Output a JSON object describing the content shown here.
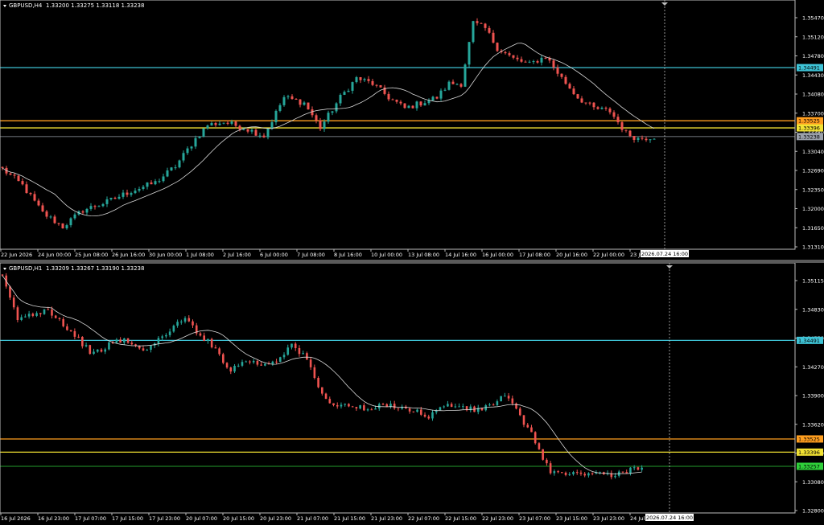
{
  "charts": [
    {
      "symbol": "GBPUSD,H4",
      "ohlc": "1.33200 1.33275 1.33118 1.33238",
      "y_axis": {
        "min": 1.3119,
        "max": 1.3572,
        "ticks": [
          "1.35470",
          "1.35120",
          "1.34780",
          "1.34430",
          "1.34080",
          "1.33700",
          "1.33380",
          "1.33040",
          "1.32690",
          "1.32350",
          "1.32000",
          "1.31650",
          "1.31310"
        ]
      },
      "x_labels": [
        "22 Jun 2026",
        "24 Jun 00:00",
        "25 Jun 08:00",
        "26 Jun 16:00",
        "30 Jun 00:00",
        "1 Jul 08:00",
        "2 Jul 16:00",
        "6 Jul 00:00",
        "7 Jul 08:00",
        "8 Jul 16:00",
        "10 Jul 00:00",
        "13 Jul 08:00",
        "14 Jul 16:00",
        "16 Jul 00:00",
        "17 Jul 08:00",
        "20 Jul 16:00",
        "22 Jul 00:00",
        "23 Jul"
      ],
      "cursor_time": "2026.07.24 16:00",
      "levels": [
        {
          "label": "1.34491",
          "value": 1.34491,
          "color": "#3ec3d6"
        },
        {
          "label": "1.33525",
          "value": 1.33525,
          "color": "#ff9e1f"
        },
        {
          "label": "1.33396",
          "value": 1.33396,
          "color": "#f2e233"
        }
      ],
      "current": {
        "label": "1.33238",
        "value": 1.33238,
        "color": "#9aa0aa"
      },
      "anchors": [
        [
          0,
          1.3265
        ],
        [
          5,
          1.3235
        ],
        [
          10,
          1.3185
        ],
        [
          15,
          1.316
        ],
        [
          20,
          1.319
        ],
        [
          26,
          1.3205
        ],
        [
          32,
          1.3225
        ],
        [
          38,
          1.324
        ],
        [
          43,
          1.327
        ],
        [
          48,
          1.332
        ],
        [
          51,
          1.3345
        ],
        [
          55,
          1.335
        ],
        [
          60,
          1.334
        ],
        [
          65,
          1.3325
        ],
        [
          70,
          1.3395
        ],
        [
          75,
          1.3385
        ],
        [
          79,
          1.334
        ],
        [
          84,
          1.3395
        ],
        [
          88,
          1.343
        ],
        [
          92,
          1.342
        ],
        [
          96,
          1.3395
        ],
        [
          100,
          1.3375
        ],
        [
          104,
          1.3385
        ],
        [
          108,
          1.3395
        ],
        [
          111,
          1.342
        ],
        [
          114,
          1.342
        ],
        [
          117,
          1.353
        ],
        [
          120,
          1.352
        ],
        [
          123,
          1.3485
        ],
        [
          127,
          1.3465
        ],
        [
          131,
          1.3455
        ],
        [
          135,
          1.347
        ],
        [
          139,
          1.343
        ],
        [
          143,
          1.3395
        ],
        [
          147,
          1.3375
        ],
        [
          151,
          1.337
        ],
        [
          155,
          1.333
        ],
        [
          158,
          1.332
        ],
        [
          162,
          1.3324
        ]
      ]
    },
    {
      "symbol": "GBPUSD,H1",
      "ohlc": "1.33209 1.33267 1.33190 1.33238",
      "y_axis": {
        "min": 1.328,
        "max": 1.3525,
        "ticks": [
          "1.35115",
          "1.34830",
          "1.34550",
          "1.34270",
          "1.33900",
          "1.33620",
          "1.33340",
          "1.33080",
          "1.32800"
        ]
      },
      "x_labels": [
        "16 Jul 2026",
        "16 Jul 23:00",
        "17 Jul 07:00",
        "17 Jul 15:00",
        "17 Jul 23:00",
        "20 Jul 07:00",
        "20 Jul 15:00",
        "20 Jul 23:00",
        "21 Jul 07:00",
        "21 Jul 15:00",
        "21 Jul 23:00",
        "22 Jul 07:00",
        "22 Jul 15:00",
        "22 Jul 23:00",
        "23 Jul 07:00",
        "23 Jul 15:00",
        "23 Jul 23:00",
        "24 Jul 0"
      ],
      "cursor_time": "2026.07.24 16:00",
      "levels": [
        {
          "label": "1.34491",
          "value": 1.34491,
          "color": "#3ec3d6"
        },
        {
          "label": "1.33525",
          "value": 1.33525,
          "color": "#ff9e1f"
        },
        {
          "label": "1.33396",
          "value": 1.33396,
          "color": "#f2e233"
        }
      ],
      "current": {
        "label": "1.33257",
        "value": 1.33257,
        "color": "#2fcf3a"
      },
      "anchors": [
        [
          0,
          1.351
        ],
        [
          4,
          1.347
        ],
        [
          8,
          1.3475
        ],
        [
          12,
          1.348
        ],
        [
          16,
          1.3465
        ],
        [
          20,
          1.345
        ],
        [
          24,
          1.3435
        ],
        [
          28,
          1.3445
        ],
        [
          32,
          1.345
        ],
        [
          36,
          1.344
        ],
        [
          40,
          1.3445
        ],
        [
          44,
          1.346
        ],
        [
          48,
          1.347
        ],
        [
          52,
          1.3455
        ],
        [
          56,
          1.344
        ],
        [
          60,
          1.342
        ],
        [
          64,
          1.343
        ],
        [
          68,
          1.3425
        ],
        [
          72,
          1.343
        ],
        [
          76,
          1.3445
        ],
        [
          80,
          1.343
        ],
        [
          84,
          1.3395
        ],
        [
          88,
          1.3385
        ],
        [
          92,
          1.3385
        ],
        [
          96,
          1.338
        ],
        [
          100,
          1.3385
        ],
        [
          104,
          1.3385
        ],
        [
          108,
          1.338
        ],
        [
          112,
          1.3375
        ],
        [
          116,
          1.3385
        ],
        [
          120,
          1.3385
        ],
        [
          124,
          1.338
        ],
        [
          128,
          1.3385
        ],
        [
          132,
          1.3395
        ],
        [
          136,
          1.3375
        ],
        [
          140,
          1.335
        ],
        [
          144,
          1.332
        ],
        [
          148,
          1.3318
        ],
        [
          152,
          1.3318
        ],
        [
          156,
          1.332
        ],
        [
          160,
          1.3315
        ],
        [
          164,
          1.3322
        ],
        [
          168,
          1.3326
        ]
      ]
    }
  ]
}
